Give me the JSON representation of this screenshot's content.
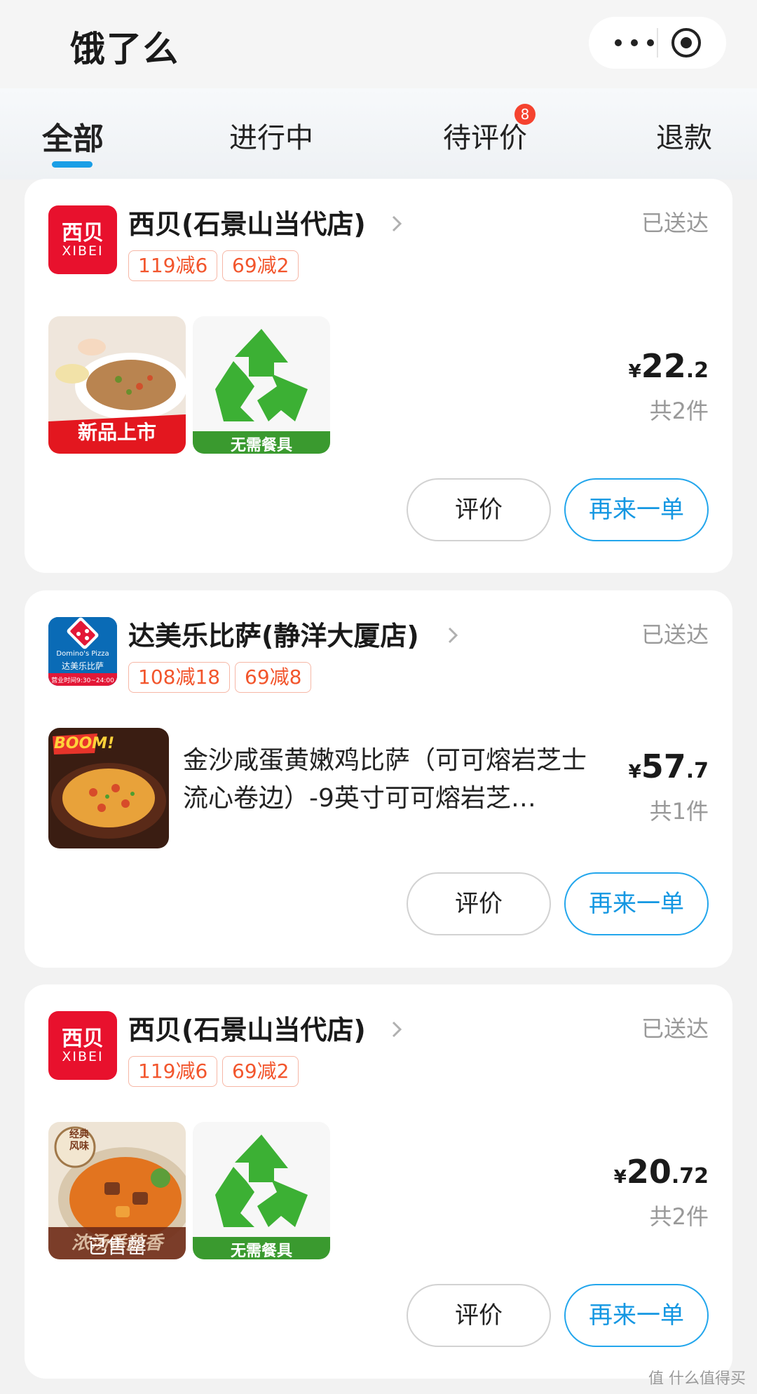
{
  "app": {
    "title": "饿了么"
  },
  "capsule": {
    "more_icon": "ellipsis-icon",
    "close_icon": "target-circle-icon"
  },
  "tabs": [
    {
      "label": "全部",
      "active": true
    },
    {
      "label": "进行中"
    },
    {
      "label": "待评价",
      "badge": "8"
    },
    {
      "label": "退款"
    }
  ],
  "orders": [
    {
      "shop": "西贝(石景山当代店)",
      "status": "已送达",
      "tags": [
        "119减6",
        "69减2"
      ],
      "logo": {
        "text": "西贝",
        "sub": "XIBEI",
        "color": "#e8112d"
      },
      "image_text": "新品上市",
      "image2_text": "无需餐具",
      "price": {
        "currency": "¥",
        "integer": "22",
        "decimal": ".2"
      },
      "count": "共2件",
      "rate_button": "评价",
      "reorder_button": "再来一单"
    },
    {
      "shop": "达美乐比萨(静洋大厦店)",
      "status": "已送达",
      "tags": [
        "108减18",
        "69减8"
      ],
      "logo": {
        "text": "Domino's Pizza",
        "sub": "达美乐比萨",
        "hours": "营业时间9:30~24:00",
        "color": "#0a6bb6"
      },
      "image_text": "BOOM!",
      "item_name": "金沙咸蛋黄嫩鸡比萨（可可熔岩芝士流心卷边）-9英寸可可熔岩芝…",
      "price": {
        "currency": "¥",
        "integer": "57",
        "decimal": ".7"
      },
      "count": "共1件",
      "rate_button": "评价",
      "reorder_button": "再来一单"
    },
    {
      "shop": "西贝(石景山当代店)",
      "status": "已送达",
      "tags": [
        "119减6",
        "69减2"
      ],
      "logo": {
        "text": "西贝",
        "sub": "XIBEI",
        "color": "#e8112d"
      },
      "image_text": "浓汤番茄香",
      "image_overlay": "已售罄",
      "image_badge": "经典风味",
      "image2_text": "无需餐具",
      "price": {
        "currency": "¥",
        "integer": "20",
        "decimal": ".72"
      },
      "count": "共2件",
      "rate_button": "评价",
      "reorder_button": "再来一单"
    }
  ],
  "watermark": "值 什么值得买",
  "colors": {
    "accent": "#1a9ee6",
    "tag": "#f2552c",
    "badge": "#f5432f",
    "recycle": "#3cb034"
  }
}
